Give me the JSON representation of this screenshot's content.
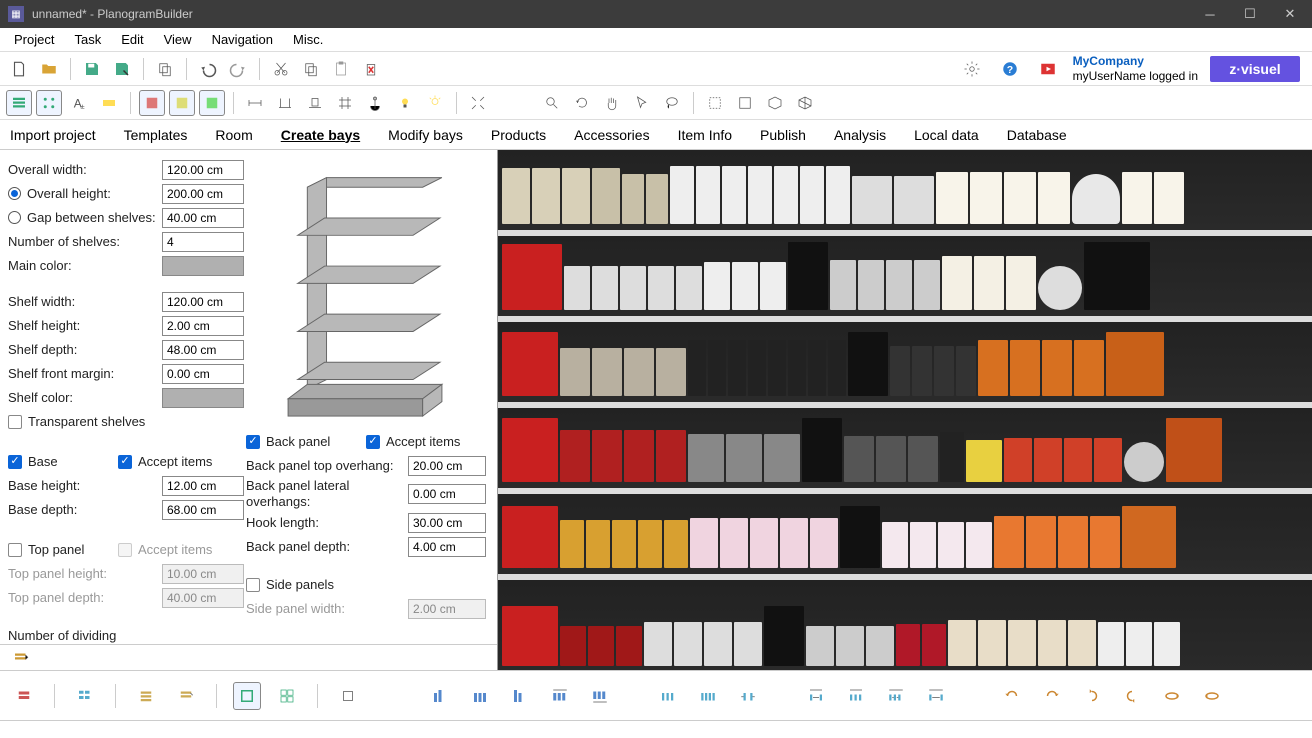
{
  "window": {
    "title": "unnamed* - PlanogramBuilder"
  },
  "menu": {
    "items": [
      "Project",
      "Task",
      "Edit",
      "View",
      "Navigation",
      "Misc."
    ]
  },
  "user": {
    "company": "MyCompany",
    "status": "myUserName logged in",
    "logo": "z·visuel"
  },
  "tabs": {
    "items": [
      "Import project",
      "Templates",
      "Room",
      "Create bays",
      "Modify bays",
      "Products",
      "Accessories",
      "Item Info",
      "Publish",
      "Analysis",
      "Local data",
      "Database"
    ],
    "active": 3
  },
  "form": {
    "overall_width": {
      "label": "Overall width:",
      "value": "120.00 cm"
    },
    "overall_height": {
      "label": "Overall height:",
      "value": "200.00 cm"
    },
    "gap_shelves": {
      "label": "Gap between shelves:",
      "value": "40.00 cm"
    },
    "num_shelves": {
      "label": "Number of shelves:",
      "value": "4"
    },
    "main_color": {
      "label": "Main color:"
    },
    "shelf_width": {
      "label": "Shelf width:",
      "value": "120.00 cm"
    },
    "shelf_height": {
      "label": "Shelf height:",
      "value": "2.00 cm"
    },
    "shelf_depth": {
      "label": "Shelf depth:",
      "value": "48.00 cm"
    },
    "shelf_margin": {
      "label": "Shelf front margin:",
      "value": "0.00 cm"
    },
    "shelf_color": {
      "label": "Shelf color:"
    },
    "transparent_shelves": {
      "label": "Transparent shelves"
    },
    "base": {
      "label": "Base"
    },
    "accept_items_base": {
      "label": "Accept items"
    },
    "base_height": {
      "label": "Base height:",
      "value": "12.00 cm"
    },
    "base_depth": {
      "label": "Base depth:",
      "value": "68.00 cm"
    },
    "top_panel": {
      "label": "Top panel"
    },
    "accept_items_top": {
      "label": "Accept items"
    },
    "top_height": {
      "label": "Top panel height:",
      "value": "10.00 cm"
    },
    "top_depth": {
      "label": "Top panel depth:",
      "value": "40.00 cm"
    },
    "num_dividing": {
      "label": "Number of dividing"
    },
    "back_panel": {
      "label": "Back panel"
    },
    "accept_items_back": {
      "label": "Accept items"
    },
    "back_top_overhang": {
      "label": "Back panel top overhang:",
      "value": "20.00 cm"
    },
    "back_lateral": {
      "label": "Back panel lateral overhangs:",
      "value": "0.00 cm"
    },
    "hook_length": {
      "label": "Hook length:",
      "value": "30.00 cm"
    },
    "back_depth": {
      "label": "Back panel depth:",
      "value": "4.00 cm"
    },
    "side_panels": {
      "label": "Side panels"
    },
    "side_width": {
      "label": "Side panel width:",
      "value": "2.00 cm"
    }
  }
}
